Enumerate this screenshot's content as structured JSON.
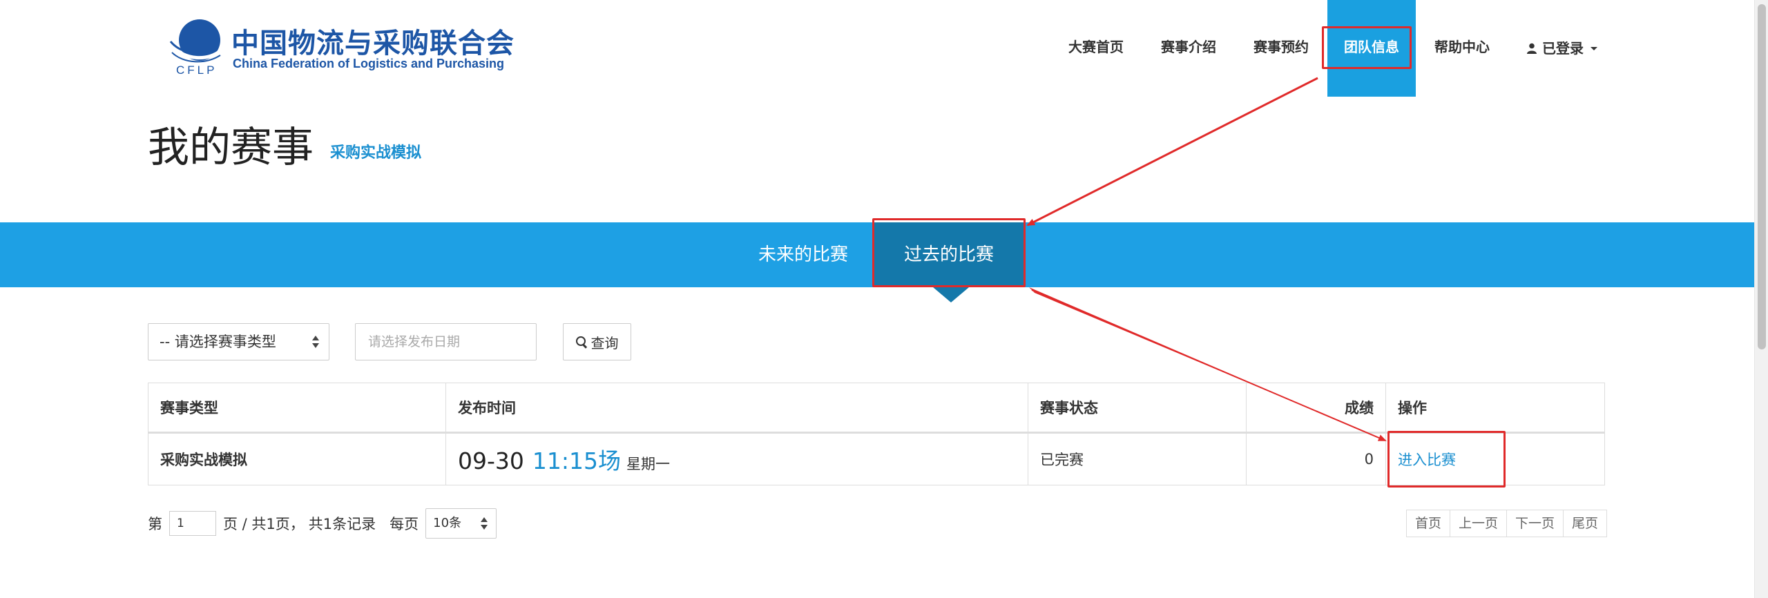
{
  "logo": {
    "cn": "中国物流与采购联合会",
    "en": "China Federation of Logistics and Purchasing",
    "abbr": "CFLP"
  },
  "nav": {
    "items": [
      {
        "label": "大赛首页"
      },
      {
        "label": "赛事介绍"
      },
      {
        "label": "赛事预约"
      },
      {
        "label": "团队信息"
      },
      {
        "label": "帮助中心"
      }
    ],
    "user_label": "已登录"
  },
  "page": {
    "title": "我的赛事",
    "subtitle": "采购实战模拟"
  },
  "tabs": {
    "future": "未来的比赛",
    "past": "过去的比赛"
  },
  "filters": {
    "type_select": "-- 请选择赛事类型",
    "date_placeholder": "请选择发布日期",
    "search_label": "查询"
  },
  "table": {
    "headers": {
      "type": "赛事类型",
      "time": "发布时间",
      "status": "赛事状态",
      "score": "成绩",
      "action": "操作"
    },
    "rows": [
      {
        "type": "采购实战模拟",
        "date": "09-30",
        "session": "11:15场",
        "weekday": "星期一",
        "status": "已完赛",
        "score": "0",
        "action": "进入比赛"
      }
    ]
  },
  "pagination": {
    "prefix": "第",
    "page_value": "1",
    "page_info": "页 / 共1页，",
    "record_info": "共1条记录",
    "per_page_label": "每页",
    "per_page_value": "10条",
    "first": "首页",
    "prev": "上一页",
    "next": "下一页",
    "last": "尾页"
  },
  "colors": {
    "brand_blue": "#1ea0e4",
    "active_tab": "#1478aa",
    "link": "#1a8fd0",
    "annotation_red": "#e02a2a"
  }
}
